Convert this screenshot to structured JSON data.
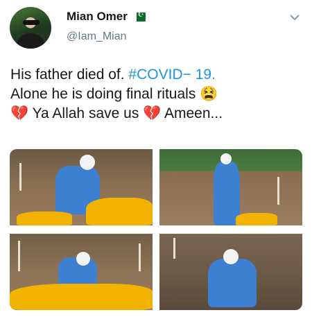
{
  "tweet": {
    "display_name": "Mian Omer",
    "handle": "@Iam_Mian",
    "text_line1_prefix": "His father died of. ",
    "hashtag": "#COVID",
    "text_line1_suffix": "− 19.",
    "text_line2": "Alone he is doing final rituals 😫",
    "text_line3_emoji1": "💔",
    "text_line3_middle": " Ya Allah save us ",
    "text_line3_emoji2": "💔",
    "text_line3_end": " Ameen..."
  },
  "icons": {
    "avatar": "avatar-image",
    "flag": "pakistan-flag-icon",
    "menu": "chevron-down-icon"
  },
  "colors": {
    "hashtag": "#1b95e0",
    "name": "#14171a",
    "handle": "#657786"
  }
}
